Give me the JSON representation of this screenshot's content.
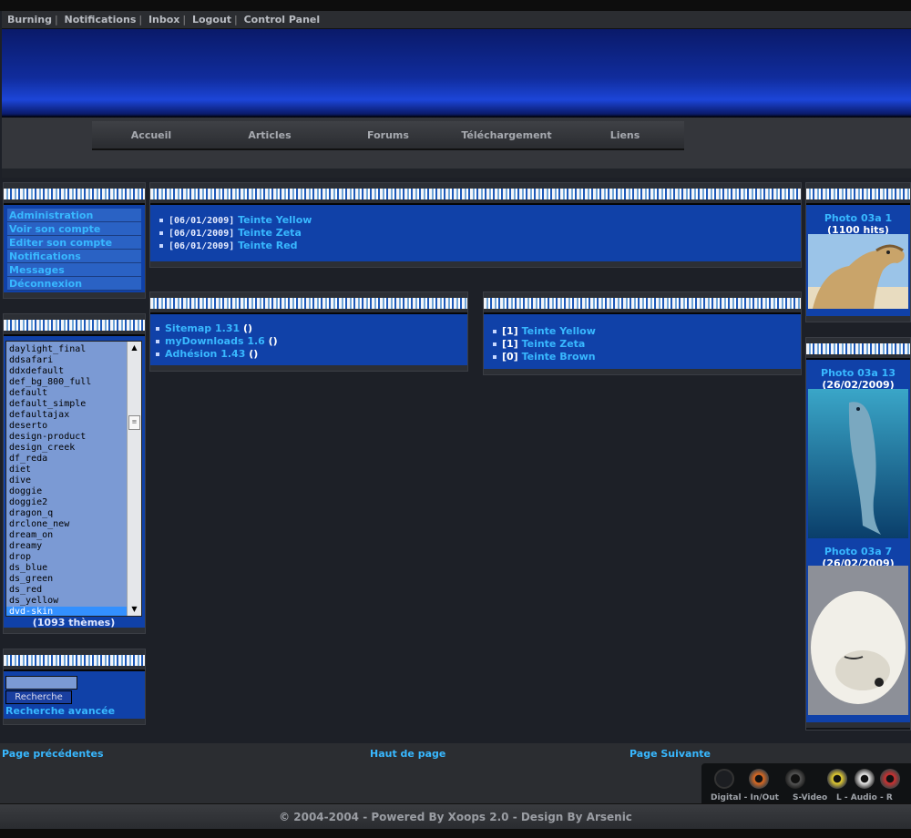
{
  "topbar": {
    "links": [
      "Burning",
      "Notifications",
      "Inbox",
      "Logout",
      "Control Panel"
    ]
  },
  "nav": {
    "items": [
      "Accueil",
      "Articles",
      "Forums",
      "Téléchargement",
      "Liens"
    ]
  },
  "user_menu": {
    "items": [
      "Administration",
      "Voir son compte",
      "Editer son compte",
      "Notifications",
      "Messages",
      "Déconnexion"
    ]
  },
  "themes": {
    "options": [
      "daylight_final",
      "ddsafari",
      "ddxdefault",
      "def_bg_800_full",
      "default",
      "default_simple",
      "defaultajax",
      "deserto",
      "design-product",
      "design_creek",
      "df_reda",
      "diet",
      "dive",
      "doggie",
      "doggie2",
      "dragon_q",
      "drclone_new",
      "dream_on",
      "dreamy",
      "drop",
      "ds_blue",
      "ds_green",
      "ds_red",
      "ds_yellow",
      "dvd-skin"
    ],
    "selected": "dvd-skin",
    "count": "(1093 thèmes)"
  },
  "search": {
    "button": "Recherche",
    "advanced": "Recherche avancée"
  },
  "recent_articles": [
    {
      "date": "[06/01/2009]",
      "title": "Teinte Yellow"
    },
    {
      "date": "[06/01/2009]",
      "title": "Teinte Zeta"
    },
    {
      "date": "[06/01/2009]",
      "title": "Teinte Red"
    }
  ],
  "downloads": [
    {
      "title": "Sitemap 1.31",
      "suffix": "()"
    },
    {
      "title": "myDownloads 1.6",
      "suffix": "()"
    },
    {
      "title": "Adhésion 1.43",
      "suffix": "()"
    }
  ],
  "top_articles": [
    {
      "rank": "[1]",
      "title": "Teinte Yellow"
    },
    {
      "rank": "[1]",
      "title": "Teinte Zeta"
    },
    {
      "rank": "[0]",
      "title": "Teinte Brown"
    }
  ],
  "top_photo": {
    "title": "Photo 03a 1",
    "meta": "(1100 hits)"
  },
  "new_photos": [
    {
      "title": "Photo 03a 13",
      "meta": "(26/02/2009)"
    },
    {
      "title": "Photo 03a 7",
      "meta": "(26/02/2009)"
    }
  ],
  "footer": {
    "prev": "Page précédentes",
    "top": "Haut de page",
    "next": "Page Suivante",
    "copyright": "© 2004-2004 - Powered By Xoops 2.0 - Design By Arsenic"
  },
  "jacks": {
    "labels": [
      "Digital - In/Out",
      "S-Video",
      "L - Audio - R"
    ]
  },
  "colors": {
    "link": "#38b8ff",
    "block_body": "#1041a8",
    "page_bg": "#1d2027"
  }
}
